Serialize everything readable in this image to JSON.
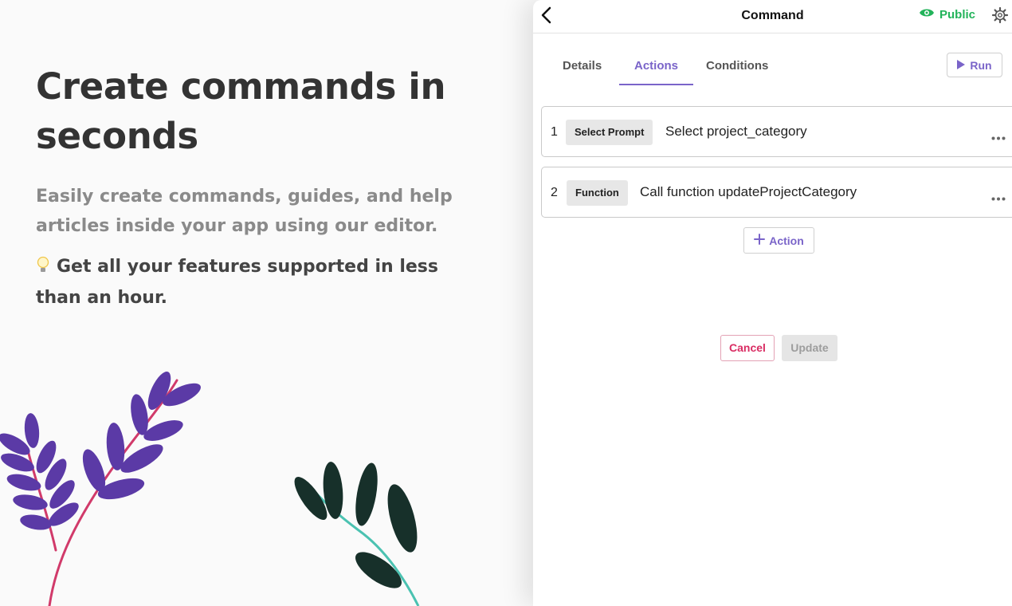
{
  "hero": {
    "title_line1": "Create commands in",
    "title_line2": "seconds",
    "subtitle_line1": "Easily create commands, guides, and help",
    "subtitle_line2": "articles inside your app using our editor.",
    "tip_icon": "lightbulb-icon",
    "tip_line1": "Get all your features supported in less",
    "tip_line2": "than an hour."
  },
  "panel": {
    "title": "Command",
    "back_icon": "back-arrow-icon",
    "visibility": {
      "icon": "eye-icon",
      "label": "Public",
      "color": "#22b35a"
    },
    "settings_icon": "gear-icon",
    "tabs": [
      {
        "label": "Details",
        "active": false
      },
      {
        "label": "Actions",
        "active": true
      },
      {
        "label": "Conditions",
        "active": false
      }
    ],
    "run_button": {
      "icon": "play-icon",
      "label": "Run"
    },
    "steps": [
      {
        "number": "1",
        "type": "Select Prompt",
        "description": "Select project_category",
        "menu_icon": "more-horizontal-icon"
      },
      {
        "number": "2",
        "type": "Function",
        "description": "Call function updateProjectCategory",
        "menu_icon": "more-horizontal-icon"
      }
    ],
    "add_action": {
      "icon": "plus-icon",
      "label": "Action"
    },
    "cancel_label": "Cancel",
    "update_label": "Update"
  },
  "colors": {
    "accent": "#7a64c9",
    "public": "#22b35a",
    "cancel": "#d92d63",
    "leaf_purple": "#5b3aa6",
    "leaf_dark": "#17302a",
    "stem_pink": "#d13a6a",
    "stem_teal": "#4bc2b1"
  }
}
